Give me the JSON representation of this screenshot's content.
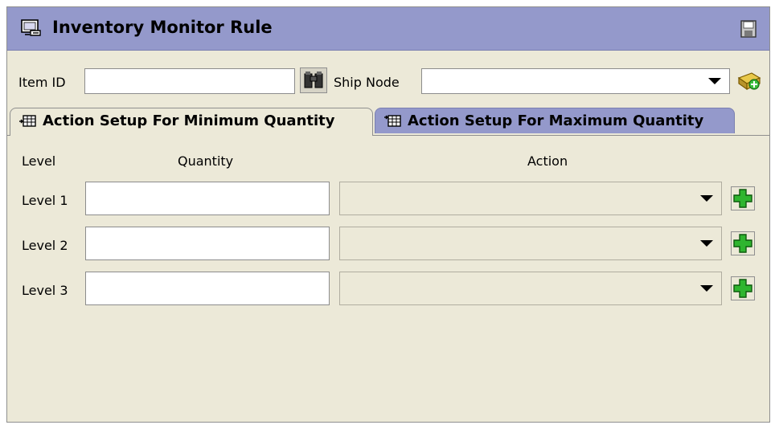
{
  "window": {
    "title": "Inventory Monitor Rule"
  },
  "criteria": {
    "item_id_label": "Item ID",
    "item_id_value": "",
    "ship_node_label": "Ship Node",
    "ship_node_value": ""
  },
  "tabs": [
    {
      "label": "Action Setup For Minimum Quantity",
      "selected": true
    },
    {
      "label": "Action Setup For Maximum Quantity",
      "selected": false
    }
  ],
  "grid": {
    "headers": {
      "level": "Level",
      "quantity": "Quantity",
      "action": "Action"
    },
    "rows": [
      {
        "level": "Level 1",
        "quantity": "",
        "action": ""
      },
      {
        "level": "Level 2",
        "quantity": "",
        "action": ""
      },
      {
        "level": "Level 3",
        "quantity": "",
        "action": ""
      }
    ]
  },
  "colors": {
    "header_bg": "#9499cb",
    "panel_bg": "#ece9d8",
    "add_green": "#2fb52f"
  },
  "icons": {
    "title": "monitor-rule-icon",
    "save": "save-icon",
    "lookup": "binoculars-icon",
    "node_action": "node-lookup-icon",
    "add": "add-icon"
  }
}
